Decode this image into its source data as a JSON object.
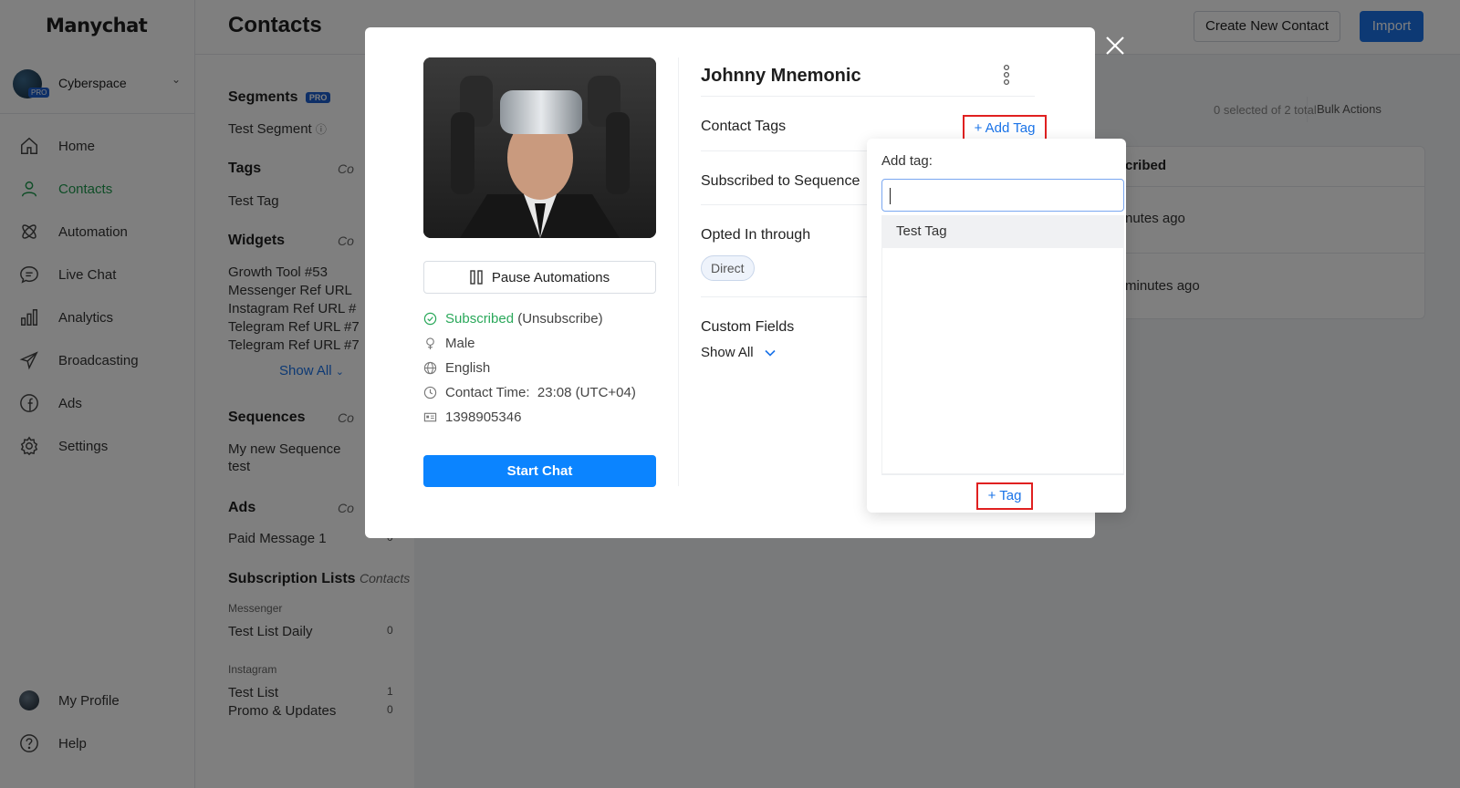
{
  "app": {
    "logo": "Manychat"
  },
  "workspace": {
    "name": "Cyberspace",
    "badge": "PRO"
  },
  "nav": {
    "items": [
      {
        "label": "Home",
        "icon": "home-icon"
      },
      {
        "label": "Contacts",
        "icon": "user-icon",
        "active": true
      },
      {
        "label": "Automation",
        "icon": "automation-icon"
      },
      {
        "label": "Live Chat",
        "icon": "chat-bubble-icon"
      },
      {
        "label": "Analytics",
        "icon": "bar-chart-icon"
      },
      {
        "label": "Broadcasting",
        "icon": "paper-plane-icon"
      },
      {
        "label": "Ads",
        "icon": "facebook-icon"
      },
      {
        "label": "Settings",
        "icon": "gear-icon"
      }
    ],
    "profile": "My Profile",
    "help": "Help"
  },
  "header": {
    "title": "Contacts",
    "create_button": "Create New Contact",
    "import_button": "Import"
  },
  "filters": {
    "segments_title": "Segments",
    "segments_badge": "PRO",
    "segment_item": "Test Segment",
    "tags_title": "Tags",
    "tags_col": "Co",
    "tag_item": "Test Tag",
    "widgets_title": "Widgets",
    "widgets_col": "Co",
    "widgets": [
      "Growth Tool #53",
      "Messenger Ref URL",
      "Instagram Ref URL #",
      "Telegram Ref URL #7",
      "Telegram Ref URL #7"
    ],
    "show_all": "Show All",
    "sequences_title": "Sequences",
    "sequences_col": "Co",
    "sequence_item": "My new Sequence",
    "sequence_item2": "test",
    "ads_title": "Ads",
    "ads_col": "Co",
    "ads_item": "Paid Message 1",
    "ads_count": "0",
    "sublists_title": "Subscription Lists",
    "sublists_col": "Contacts",
    "messenger_label": "Messenger",
    "list_daily": "Test List Daily",
    "list_daily_count": "0",
    "instagram_label": "Instagram",
    "list_test": "Test List",
    "list_test_count": "1",
    "list_promo": "Promo & Updates",
    "list_promo_count": "0"
  },
  "table": {
    "selected_text": "0 selected of 2 total",
    "bulk_actions": "Bulk Actions",
    "col_header": "cribed",
    "row1": "nutes ago",
    "row2": "minutes ago"
  },
  "modal": {
    "contact_name": "Johnny Mnemonic",
    "pause_automations": "Pause Automations",
    "subscribed": "Subscribed",
    "unsubscribe": "(Unsubscribe)",
    "gender": "Male",
    "language": "English",
    "contact_time_label": "Contact Time:",
    "contact_time_value": "23:08 (UTC+04)",
    "contact_id": "1398905346",
    "start_chat": "Start Chat",
    "contact_tags_label": "Contact Tags",
    "add_tag": "+ Add Tag",
    "subscribed_to_sequence": "Subscribed to Sequence",
    "opted_in_label": "Opted In through",
    "opted_in_chip": "Direct",
    "custom_fields_label": "Custom Fields",
    "show_all": "Show All"
  },
  "tag_dropdown": {
    "label": "Add tag:",
    "input_value": "",
    "options": [
      "Test Tag"
    ],
    "create_tag": "+ Tag"
  },
  "colors": {
    "accent": "#1a73e8",
    "active_nav": "#1e9a4e",
    "highlight": "#e02020",
    "start_chat": "#0b84ff"
  }
}
